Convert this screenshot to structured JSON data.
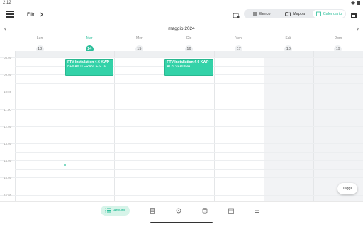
{
  "status": {
    "time": "2:12"
  },
  "header": {
    "filter_label": "Filtri",
    "views": [
      {
        "label": "Elenco",
        "icon": "list-icon",
        "active": false
      },
      {
        "label": "Mappa",
        "icon": "map-icon",
        "active": false
      },
      {
        "label": "Calendario",
        "icon": "calendar-icon",
        "active": true
      }
    ]
  },
  "calendar": {
    "month_title": "maggio 2024",
    "days": [
      {
        "name": "Lun",
        "date": "13",
        "today": false
      },
      {
        "name": "Mar",
        "date": "14",
        "today": true
      },
      {
        "name": "Mer",
        "date": "15",
        "today": false
      },
      {
        "name": "Gio",
        "date": "16",
        "today": false
      },
      {
        "name": "Ven",
        "date": "17",
        "today": false
      },
      {
        "name": "Sab",
        "date": "18",
        "today": false
      },
      {
        "name": "Dom",
        "date": "19",
        "today": false
      }
    ],
    "hours": [
      "08:00",
      "09:00",
      "10:00",
      "11:00",
      "12:00",
      "13:00",
      "14:00",
      "15:00",
      "16:00"
    ],
    "events": [
      {
        "title": "FTV Installation 4-6 KWP",
        "subtitle": "BENANTI FRANCESCA",
        "day_index": 1
      },
      {
        "title": "FTV Installation 4-6 KWP",
        "subtitle": "ACS VERONA",
        "day_index": 3
      }
    ]
  },
  "today_button": "Oggi",
  "bottom_nav": [
    {
      "label": "Attività",
      "icon": "activities-icon",
      "active": true
    },
    {
      "label": "",
      "icon": "warehouse-icon",
      "active": false
    },
    {
      "label": "",
      "icon": "settings-icon",
      "active": false
    },
    {
      "label": "",
      "icon": "database-icon",
      "active": false
    },
    {
      "label": "",
      "icon": "archive-icon",
      "active": false
    },
    {
      "label": "",
      "icon": "menu-lines-icon",
      "active": false
    }
  ],
  "colors": {
    "accent": "#2bbf9a",
    "event": "#33d2a8",
    "weekend": "#f2f3f5"
  }
}
